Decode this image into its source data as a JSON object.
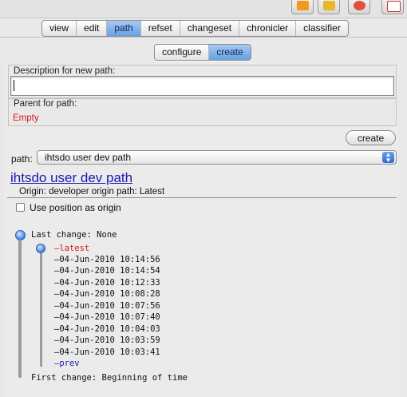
{
  "tabs": [
    "view",
    "edit",
    "path",
    "refset",
    "changeset",
    "chronicler",
    "classifier"
  ],
  "active_tab": "path",
  "subtabs": [
    "configure",
    "create"
  ],
  "active_subtab": "create",
  "create_form": {
    "description_label": "Description for new path:",
    "description_value": "",
    "parent_label": "Parent for path:",
    "parent_value": "Empty",
    "create_button": "create"
  },
  "path_select": {
    "label": "path:",
    "value": "ihtsdo user dev path"
  },
  "path_details": {
    "title": "ihtsdo user dev path",
    "origin": "Origin: developer origin path: Latest",
    "use_position_label": "Use position as origin",
    "use_position_checked": false
  },
  "history": {
    "last_change": "Last change: None",
    "latest_label": "latest",
    "entries": [
      "04-Jun-2010 10:14:56",
      "04-Jun-2010 10:14:54",
      "04-Jun-2010 10:12:33",
      "04-Jun-2010 10:08:28",
      "04-Jun-2010 10:07:56",
      "04-Jun-2010 10:07:40",
      "04-Jun-2010 10:04:03",
      "04-Jun-2010 10:03:59",
      "04-Jun-2010 10:03:41"
    ],
    "prev_label": "prev",
    "first_change": "First change: Beginning of time"
  },
  "colors": {
    "parent_value": "#d41a1a",
    "link": "#1a1ab0",
    "active_tab": "#6aa0e0"
  },
  "toolbar_icons": [
    "orange-drop-icon",
    "folder-icon",
    "network-icon",
    "checklist-icon"
  ]
}
